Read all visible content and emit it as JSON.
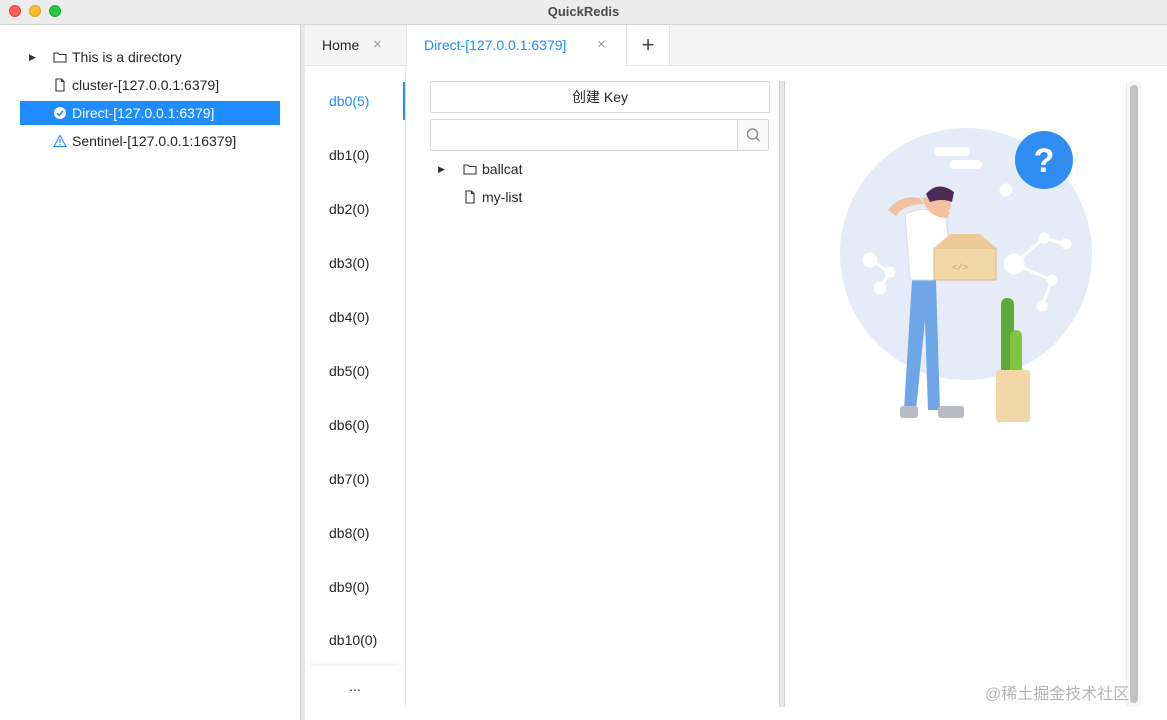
{
  "window": {
    "title": "QuickRedis"
  },
  "sidebar": {
    "items": [
      {
        "label": "This is a directory",
        "icon": "folder-icon",
        "expandable": true,
        "selected": false
      },
      {
        "label": "cluster-[127.0.0.1:6379]",
        "icon": "file-icon",
        "selected": false
      },
      {
        "label": "Direct-[127.0.0.1:6379]",
        "icon": "check-circle-icon",
        "selected": true
      },
      {
        "label": "Sentinel-[127.0.0.1:16379]",
        "icon": "warning-icon",
        "selected": false
      }
    ]
  },
  "tabs": {
    "items": [
      {
        "label": "Home",
        "close": "×"
      },
      {
        "label": "Direct-[127.0.0.1:6379]",
        "close": "×",
        "active": true
      }
    ],
    "add": "+"
  },
  "databases": {
    "items": [
      "db0(5)",
      "db1(0)",
      "db2(0)",
      "db3(0)",
      "db4(0)",
      "db5(0)",
      "db6(0)",
      "db7(0)",
      "db8(0)",
      "db9(0)",
      "db10(0)"
    ],
    "active_index": 0,
    "more": "..."
  },
  "keys": {
    "create_label": "创建 Key",
    "search_value": "",
    "search_placeholder": "",
    "tree": [
      {
        "label": "ballcat",
        "type": "folder",
        "expandable": true
      },
      {
        "label": "my-list",
        "type": "file"
      }
    ]
  },
  "watermark": "@稀土掘金技术社区",
  "colors": {
    "accent": "#1f8cff",
    "selected_bg": "#1f8cff"
  }
}
